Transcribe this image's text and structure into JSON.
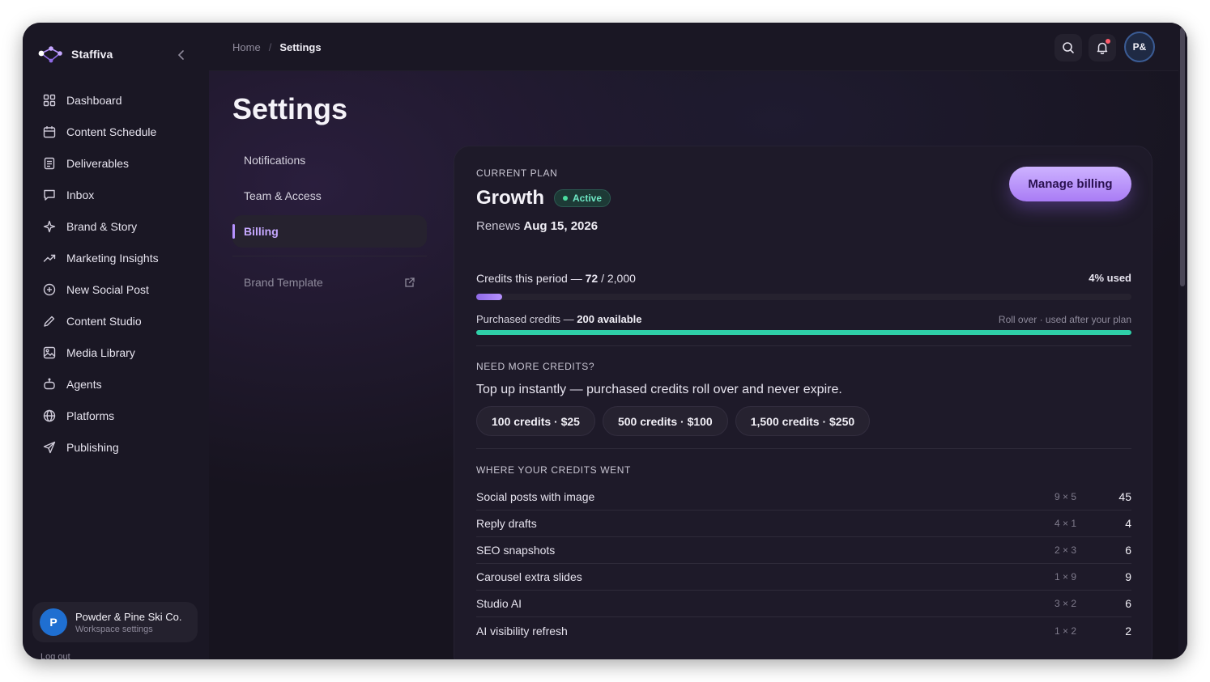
{
  "app": {
    "name": "Staffiva",
    "icons": {
      "logo": "staffiva-logo",
      "collapse": "chevron-left-icon"
    }
  },
  "sidebar": {
    "items": [
      {
        "label": "Dashboard",
        "icon": "dashboard-grid-icon"
      },
      {
        "label": "Content Schedule",
        "icon": "calendar-icon"
      },
      {
        "label": "Deliverables",
        "icon": "document-icon"
      },
      {
        "label": "Inbox",
        "icon": "message-icon"
      },
      {
        "label": "Brand & Story",
        "icon": "sparkle-icon"
      },
      {
        "label": "Marketing Insights",
        "icon": "trend-icon"
      },
      {
        "label": "New Social Post",
        "icon": "plus-square-icon"
      },
      {
        "label": "Content Studio",
        "icon": "pencil-icon"
      },
      {
        "label": "Media Library",
        "icon": "image-icon"
      },
      {
        "label": "Agents",
        "icon": "robot-icon"
      },
      {
        "label": "Platforms",
        "icon": "globe-icon"
      },
      {
        "label": "Publishing",
        "icon": "send-icon"
      }
    ],
    "workspace": {
      "avatar_letter": "P",
      "name": "Powder & Pine Ski Co.",
      "subtitle": "Workspace settings"
    },
    "logout_label": "Log out"
  },
  "topbar": {
    "breadcrumb": {
      "home": "Home",
      "separator": "/",
      "current": "Settings"
    },
    "user_initials": "P&",
    "icons": {
      "search": "search-icon",
      "notifications": "bell-icon"
    }
  },
  "page": {
    "title": "Settings",
    "subnav": {
      "items": [
        "Notifications",
        "Team & Access",
        "Billing"
      ],
      "active": "Billing",
      "external": "Brand Template"
    }
  },
  "billing": {
    "current_plan_label": "CURRENT PLAN",
    "plan_name": "Growth",
    "status": "Active",
    "renews_prefix": "Renews",
    "renews_date": "Aug 15, 2026",
    "manage_label": "Manage billing",
    "credits": {
      "label_prefix": "Credits this period —",
      "used": "72",
      "sep": "/",
      "total": "2,000",
      "used_pct_text": "4% used",
      "fill_fraction": 0.04
    },
    "purchased": {
      "label_prefix": "Purchased credits —",
      "available": "200 available",
      "note": "Roll over · used after your plan",
      "fill_fraction": 1.0
    },
    "more_label": "NEED MORE CREDITS?",
    "more_text": "Top up instantly — purchased credits roll over and never expire.",
    "topups": [
      "100 credits · $25",
      "500 credits · $100",
      "1,500 credits · $250"
    ],
    "usage_label": "WHERE YOUR CREDITS WENT",
    "usage": [
      {
        "name": "Social posts with image",
        "calc": "9 × 5",
        "total": "45"
      },
      {
        "name": "Reply drafts",
        "calc": "4 × 1",
        "total": "4"
      },
      {
        "name": "SEO snapshots",
        "calc": "2 × 3",
        "total": "6"
      },
      {
        "name": "Carousel extra slides",
        "calc": "1 × 9",
        "total": "9"
      },
      {
        "name": "Studio AI",
        "calc": "3 × 2",
        "total": "6"
      },
      {
        "name": "AI visibility refresh",
        "calc": "1 × 2",
        "total": "2"
      }
    ]
  },
  "colors": {
    "accent": "#b692ff",
    "active_green": "#4ade9f",
    "purchased_bar": "#2fcfa8",
    "background": "#17141f"
  }
}
